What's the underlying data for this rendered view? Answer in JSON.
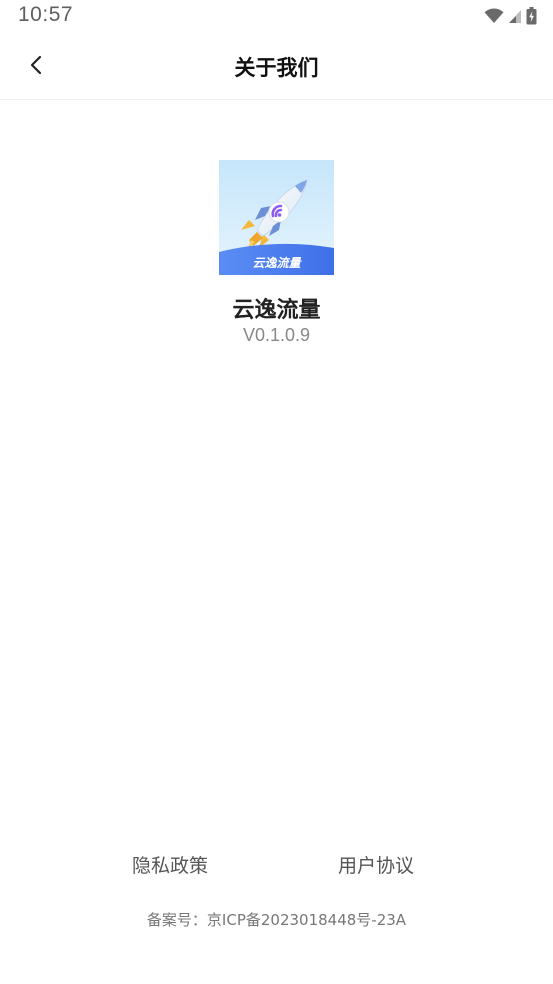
{
  "status_bar": {
    "time": "10:57",
    "icons": [
      "wifi-icon",
      "cell-signal-icon",
      "battery-charging-icon"
    ]
  },
  "header": {
    "back_icon": "chevron-left-icon",
    "title": "关于我们"
  },
  "app": {
    "logo_caption": "云逸流量",
    "logo_icon": "rocket-icon",
    "name": "云逸流量",
    "version": "V0.1.0.9"
  },
  "footer": {
    "privacy_label": "隐私政策",
    "terms_label": "用户协议",
    "icp_record": "备案号：京ICP备2023018448号-23A"
  },
  "colors": {
    "logo_sky_top": "#c9e8fb",
    "logo_wave": "#4d7cf0",
    "rocket_body": "#ffffff",
    "rocket_accent": "#8a5cf0",
    "flame": "#f5b73b"
  }
}
